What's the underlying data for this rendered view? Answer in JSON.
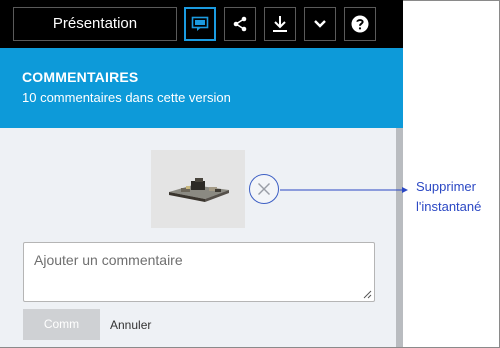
{
  "toolbar": {
    "presentation_label": "Présentation",
    "icons": {
      "comments": "comment-icon",
      "share": "share-icon",
      "download": "download-icon",
      "more": "chevron-down-icon",
      "help": "help-icon"
    }
  },
  "header": {
    "title": "COMMENTAIRES",
    "subtitle": "10 commentaires dans cette version"
  },
  "comment_form": {
    "placeholder": "Ajouter un commentaire",
    "submit_label": "Comm",
    "cancel_label": "Annuler"
  },
  "callout": {
    "line1": "Supprimer",
    "line2": "l'instantané"
  },
  "colors": {
    "toolbar_bg": "#000000",
    "header_bg": "#0d9ad9",
    "active_icon": "#1b9be0",
    "content_bg": "#eef1f5",
    "callout": "#2b48c4"
  }
}
